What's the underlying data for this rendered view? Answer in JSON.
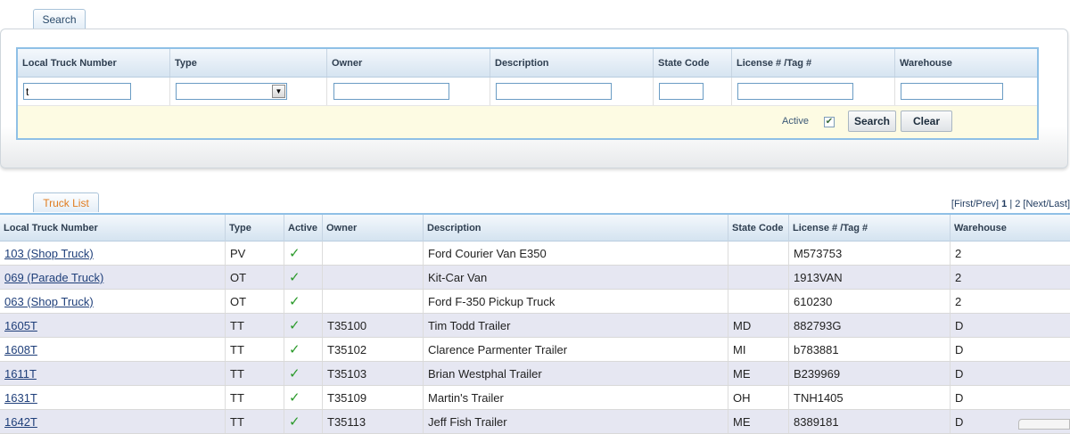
{
  "search_tab": {
    "label": "Search"
  },
  "search": {
    "columns": [
      "Local Truck Number",
      "Type",
      "Owner",
      "Description",
      "State Code",
      "License # /Tag #",
      "Warehouse"
    ],
    "local_truck_number_value": "t",
    "type_value": "",
    "owner_value": "",
    "description_value": "",
    "state_code_value": "",
    "license_value": "",
    "warehouse_value": "",
    "active_label": "Active",
    "active_checked": true,
    "search_label": "Search",
    "clear_label": "Clear"
  },
  "list_tab": {
    "label": "Truck List"
  },
  "pager": {
    "first_prev": "[First/Prev]",
    "page1": "1",
    "sep": "|",
    "page2": "2",
    "next_last": "[Next/Last]"
  },
  "table": {
    "columns": [
      "Local Truck Number",
      "Type",
      "Active",
      "Owner",
      "Description",
      "State Code",
      "License # /Tag #",
      "Warehouse"
    ],
    "rows": [
      {
        "number": "103 (Shop Truck)",
        "type": "PV",
        "active": "✓",
        "owner": "",
        "description": "Ford Courier Van E350",
        "state": "",
        "license": "M573753",
        "warehouse": "2"
      },
      {
        "number": "069 (Parade Truck)",
        "type": "OT",
        "active": "✓",
        "owner": "",
        "description": "Kit-Car Van",
        "state": "",
        "license": "1913VAN",
        "warehouse": "2"
      },
      {
        "number": "063 (Shop Truck)",
        "type": "OT",
        "active": "✓",
        "owner": "",
        "description": "Ford F-350 Pickup Truck",
        "state": "",
        "license": "610230",
        "warehouse": "2"
      },
      {
        "number": "1605T",
        "type": "TT",
        "active": "✓",
        "owner": "T35100",
        "description": "Tim Todd Trailer",
        "state": "MD",
        "license": "882793G",
        "warehouse": "D"
      },
      {
        "number": "1608T",
        "type": "TT",
        "active": "✓",
        "owner": "T35102",
        "description": "Clarence Parmenter Trailer",
        "state": "MI",
        "license": "b783881",
        "warehouse": "D"
      },
      {
        "number": "1611T",
        "type": "TT",
        "active": "✓",
        "owner": "T35103",
        "description": "Brian Westphal Trailer",
        "state": "ME",
        "license": "B239969",
        "warehouse": "D"
      },
      {
        "number": "1631T",
        "type": "TT",
        "active": "✓",
        "owner": "T35109",
        "description": "Martin's Trailer",
        "state": "OH",
        "license": "TNH1405",
        "warehouse": "D"
      },
      {
        "number": "1642T",
        "type": "TT",
        "active": "✓",
        "owner": "T35113",
        "description": "Jeff Fish Trailer",
        "state": "ME",
        "license": "8389181",
        "warehouse": "D"
      }
    ]
  }
}
